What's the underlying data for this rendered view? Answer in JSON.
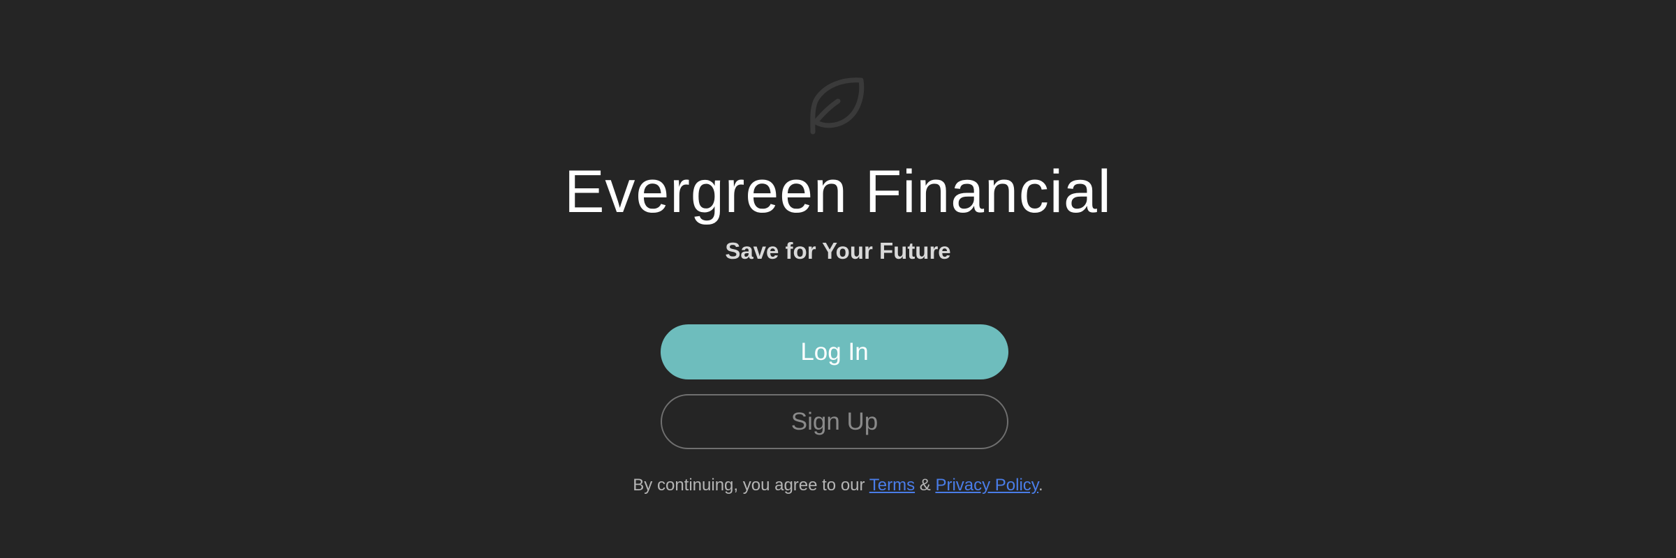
{
  "app": {
    "logo_icon": "leaf-icon",
    "title": "Evergreen Financial",
    "subtitle": "Save for Your Future"
  },
  "actions": {
    "login_label": "Log In",
    "signup_label": "Sign Up"
  },
  "legal": {
    "prefix": "By continuing, you agree to our ",
    "terms_label": "Terms",
    "separator": " & ",
    "privacy_label": "Privacy Policy",
    "suffix": "."
  },
  "colors": {
    "background": "#252525",
    "accent": "#6ebdbd",
    "link": "#4a7de8"
  }
}
